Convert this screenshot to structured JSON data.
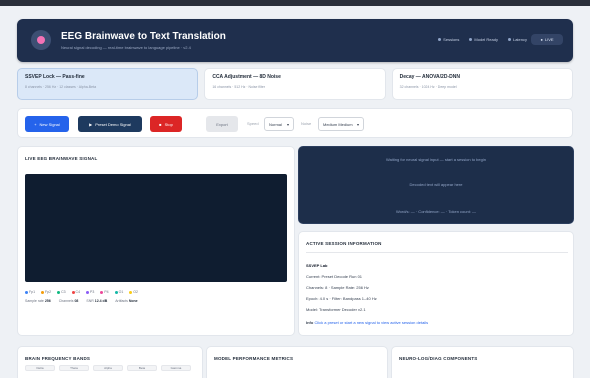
{
  "header": {
    "title": "EEG Brainwave to Text Translation",
    "subtitle": "Neural signal decoding — real-time brainwave to language pipeline · v2.4",
    "stats": [
      "Sessions",
      "Model Ready",
      "Latency"
    ],
    "pill": "LIVE"
  },
  "modes": [
    {
      "title": "SSVEP Lock — Pass-fine",
      "desc": "8 channels · 256 Hz · 12 classes · Alpha-Beta",
      "active": true
    },
    {
      "title": "CCA Adjustment — 8D Noise",
      "desc": "16 channels · 512 Hz · Noise filter",
      "active": false
    },
    {
      "title": "Decay — ANOVA/2D-DNN",
      "desc": "32 channels · 1024 Hz · Deep model",
      "active": false
    }
  ],
  "toolbar": {
    "new_signal": "New Signal",
    "preset_signal": "Preset Demo Signal",
    "stop": "Stop",
    "export": "Export",
    "speed_label": "Speed",
    "speed_value": "Normal",
    "noise_label": "Noise",
    "noise_value": "Medium Medium"
  },
  "eeg_panel": {
    "title": "LIVE EEG BRAINWAVE SIGNAL",
    "legend": [
      "Fp1",
      "Fp2",
      "C3",
      "C4",
      "P3",
      "P4",
      "O1",
      "O2"
    ],
    "stats": [
      {
        "label": "Sample rate",
        "value": "256"
      },
      {
        "label": "Channels",
        "value": "08"
      },
      {
        "label": "SNR",
        "value": "12.4 dB"
      },
      {
        "label": "Artifacts",
        "value": "None"
      }
    ]
  },
  "translation": {
    "line1": "Waiting for neural signal input — start a session to begin",
    "line2": "Decoded text will appear here",
    "line3": "Word/s: — · Confidence: — · Token count: —"
  },
  "session": {
    "title": "ACTIVE SESSION INFORMATION",
    "rows": [
      "SSVEP Lab",
      "Current: Preset Decode Run 01",
      "Channels: 8 · Sample Rate: 256 Hz",
      "Epoch: 4.0 s · Filter: Bandpass 1–40 Hz",
      "Model: Transformer Decoder v2.1"
    ],
    "link_label": "Info",
    "link_text": "Click a preset or start a new signal to view active session details"
  },
  "bottom": {
    "bands_title": "BRAIN FREQUENCY BANDS",
    "bands": [
      "Delta",
      "Theta",
      "Alpha",
      "Beta",
      "Gamma"
    ],
    "metrics_title": "MODEL PERFORMANCE METRICS",
    "log_title": "NEURO-LOG/DIAG COMPONENTS"
  },
  "colors": {
    "header_bg": "#1f2f4d",
    "accent_blue": "#2563eb",
    "dark_navy": "#1e3a5f",
    "stop_red": "#dc2626",
    "eeg_bg": "#0f1d30",
    "legend": [
      "#3b82f6",
      "#f59e0b",
      "#10b981",
      "#ef4444",
      "#8b5cf6",
      "#ec4899",
      "#14b8a6",
      "#facc15"
    ]
  }
}
